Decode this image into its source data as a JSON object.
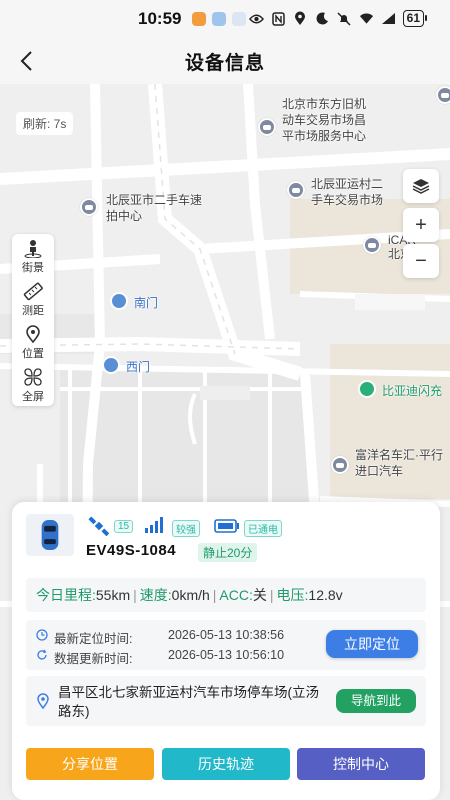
{
  "status_bar": {
    "time": "10:59",
    "battery": "61"
  },
  "header": {
    "title": "设备信息"
  },
  "map": {
    "refresh_label": "刷新: 7s",
    "pois": {
      "p1": "北京市东方旧机动车交易市场昌平市场服务中心",
      "p2": "北辰亚运村二手车交易市场",
      "p3": "北辰亚市二手车速拍中心",
      "p4": "iCAR",
      "p5": "北京",
      "p6": "富洋名车汇·平行进口汽车",
      "south_gate": "南门",
      "west_gate": "西门",
      "ev": "比亚迪闪充"
    },
    "tools": {
      "street": "街景",
      "measure": "测距",
      "location": "位置",
      "fullscreen": "全屏"
    },
    "controls": {
      "plus": "+",
      "minus": "−"
    }
  },
  "vehicle": {
    "satellites": "15",
    "signal": "较强",
    "power": "已通电",
    "plate": "EV49S-1084",
    "status": "静止20分"
  },
  "stats": {
    "mileage_label": "今日里程:",
    "mileage": "55km",
    "speed_label": "速度:",
    "speed": "0km/h",
    "acc_label": "ACC:",
    "acc": "关",
    "voltage_label": "电压:",
    "voltage": "12.8v"
  },
  "times": {
    "locate_label": "最新定位时间:",
    "locate_time": "2026-05-13 10:38:56",
    "update_label": "数据更新时间:",
    "update_time": "2026-05-13 10:56:10",
    "locate_button": "立即定位"
  },
  "address": {
    "text": "昌平区北七家新亚运村汽车市场停车场(立汤路东)",
    "navigate_button": "导航到此"
  },
  "actions": {
    "share": "分享位置",
    "history": "历史轨迹",
    "control": "控制中心"
  },
  "colors": {
    "accent_blue": "#3d7ee6",
    "green": "#23a163",
    "orange": "#f7a61c",
    "teal": "#21b9c9",
    "indigo": "#5660c4"
  }
}
